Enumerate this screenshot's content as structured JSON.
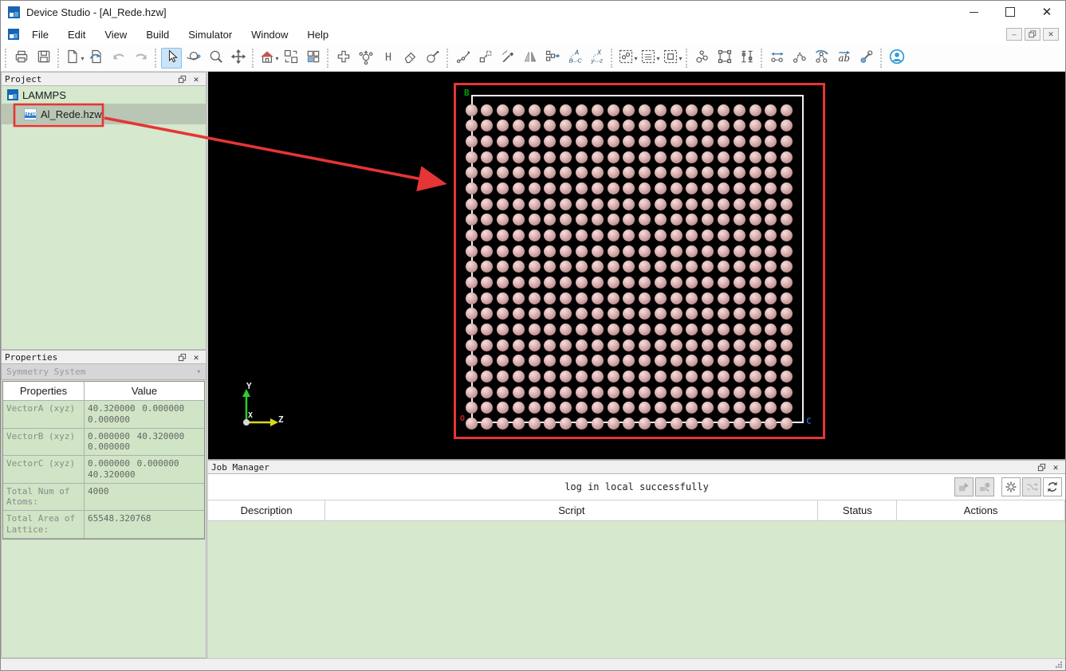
{
  "window": {
    "title": "Device Studio - [Al_Rede.hzw]",
    "controls": [
      "minimize",
      "maximize",
      "close"
    ]
  },
  "menu": {
    "items": [
      "File",
      "Edit",
      "View",
      "Build",
      "Simulator",
      "Window",
      "Help"
    ],
    "mdi_controls": [
      "minimize",
      "restore",
      "close"
    ]
  },
  "toolbar": {
    "groups": [
      [
        {
          "name": "open-project-icon"
        },
        {
          "name": "save-icon"
        }
      ],
      [
        {
          "name": "new-file-icon",
          "dropdown": true
        },
        {
          "name": "import-file-icon"
        },
        {
          "name": "undo-icon"
        },
        {
          "name": "redo-icon"
        }
      ],
      [
        {
          "name": "select-cursor-icon",
          "active": true
        },
        {
          "name": "rotate-view-icon"
        },
        {
          "name": "zoom-view-icon"
        },
        {
          "name": "pan-view-icon"
        }
      ],
      [
        {
          "name": "home-view-icon",
          "dropdown": true
        },
        {
          "name": "tile-windows-icon"
        },
        {
          "name": "window-grid-icon"
        }
      ],
      [
        {
          "name": "add-structure-icon"
        },
        {
          "name": "add-atom-icon"
        },
        {
          "name": "add-hydrogen-icon"
        },
        {
          "name": "eraser-icon"
        },
        {
          "name": "modify-element-icon"
        }
      ],
      [
        {
          "name": "modify-bond-icon"
        },
        {
          "name": "extend-cell-icon"
        },
        {
          "name": "edit-structure-icon"
        },
        {
          "name": "mirror-icon"
        },
        {
          "name": "replace-fragment-icon"
        },
        {
          "name": "swap-abc-axes-icon"
        },
        {
          "name": "swap-xyz-axes-icon"
        }
      ],
      [
        {
          "name": "select-atoms-icon",
          "dropdown": true
        },
        {
          "name": "select-configuration-icon",
          "dropdown": true
        },
        {
          "name": "select-region-icon",
          "dropdown": true
        }
      ],
      [
        {
          "name": "build-molecule-icon"
        },
        {
          "name": "build-supercell-icon"
        },
        {
          "name": "build-slab-icon"
        }
      ],
      [
        {
          "name": "measure-distance-icon"
        },
        {
          "name": "measure-angle-icon"
        },
        {
          "name": "measure-torsion-icon"
        },
        {
          "name": "label-ab-icon"
        },
        {
          "name": "bond-length-icon"
        }
      ],
      [
        {
          "name": "user-account-icon"
        }
      ]
    ]
  },
  "project": {
    "title": "Project",
    "tree": [
      {
        "label": "LAMMPS",
        "icon": "app-logo-icon",
        "selected": false
      },
      {
        "label": "Al_Rede.hzw",
        "icon": "hzw-file-icon",
        "selected": true
      }
    ]
  },
  "properties": {
    "title": "Properties",
    "selector": "Symmetry System",
    "columns": [
      "Properties",
      "Value"
    ],
    "rows": [
      {
        "label": "VectorA (xyz)",
        "value": "40.320000 0.000000 0.000000"
      },
      {
        "label": "VectorB (xyz)",
        "value": "0.000000 40.320000 0.000000"
      },
      {
        "label": "VectorC (xyz)",
        "value": "0.000000 0.000000 40.320000"
      },
      {
        "label": "Total Num of Atoms:",
        "value": "4000"
      },
      {
        "label": "Total Area of Lattice:",
        "value": "65548.320768"
      }
    ]
  },
  "viewport": {
    "corner_labels": {
      "b": "B",
      "origin": "O",
      "c": "C"
    },
    "axis_labels": {
      "x": "X",
      "y": "Y",
      "z": "Z"
    },
    "lattice": {
      "columns": 21,
      "rows": 21,
      "atom_color": "#d4a8a8",
      "box_color": "#f0f0f0",
      "background": "#000000"
    }
  },
  "job_manager": {
    "title": "Job Manager",
    "status_message": "log in local successfully",
    "columns": [
      {
        "label": "Description",
        "width": 13.7
      },
      {
        "label": "Script",
        "width": 57.5
      },
      {
        "label": "Status",
        "width": 9.2
      },
      {
        "label": "Actions",
        "width": 19.6
      }
    ],
    "buttons": [
      {
        "name": "submit-job-icon",
        "disabled": true
      },
      {
        "name": "submit-script-icon",
        "disabled": true
      },
      {
        "name": "separator"
      },
      {
        "name": "settings-gear-icon",
        "disabled": false
      },
      {
        "name": "transfer-icon",
        "disabled": true
      },
      {
        "name": "refresh-icon",
        "disabled": false
      }
    ]
  },
  "annotations": {
    "highlight_color": "#e53535"
  },
  "colors": {
    "panel_green": "#d6e8cd",
    "cell_green": "#cfe5c5",
    "selection_blue": "#cce4f7",
    "selected_row": "#b9c6b4",
    "axis_y": "#2ecc2e",
    "axis_z": "#d8d820",
    "label_b": "#00a000",
    "label_o": "#cc2020",
    "label_c": "#1e5fbf"
  }
}
